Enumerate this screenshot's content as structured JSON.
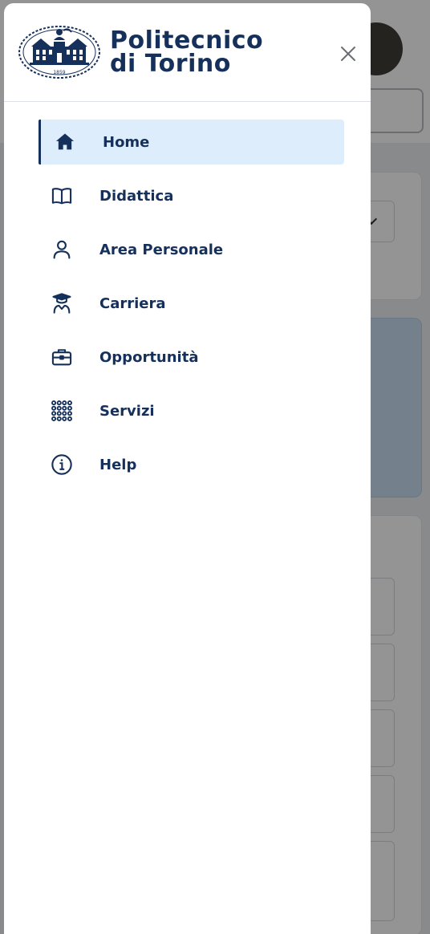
{
  "brand": {
    "line1": "Politecnico",
    "line2": "di Torino",
    "seal_year": "1859",
    "color": "#15305a"
  },
  "drawer": {
    "close_icon": "close-icon",
    "active_bg": "#deedfb",
    "nav": [
      {
        "label": "Home",
        "icon": "home-icon",
        "active": true
      },
      {
        "label": "Didattica",
        "icon": "book-icon",
        "active": false
      },
      {
        "label": "Area Personale",
        "icon": "user-icon",
        "active": false
      },
      {
        "label": "Carriera",
        "icon": "graduate-icon",
        "active": false
      },
      {
        "label": "Opportunità",
        "icon": "briefcase-icon",
        "active": false
      },
      {
        "label": "Servizi",
        "icon": "grid-icon",
        "active": false
      },
      {
        "label": "Help",
        "icon": "info-icon",
        "active": false
      }
    ]
  }
}
